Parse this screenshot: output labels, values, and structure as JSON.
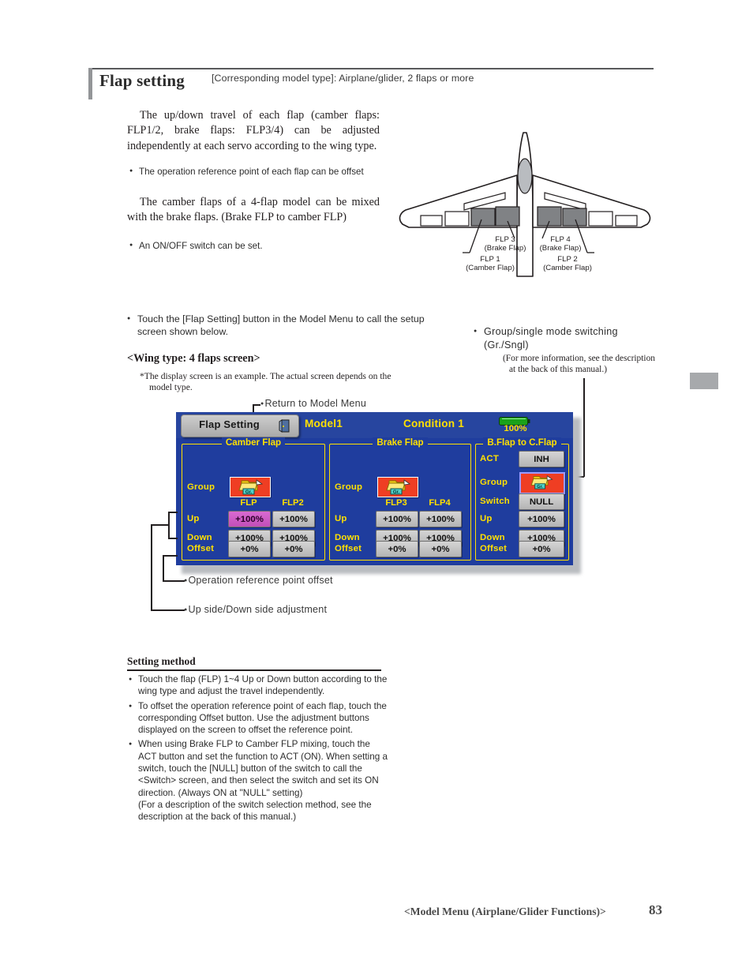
{
  "header": {
    "title": "Flap setting",
    "subtitle": "[Corresponding model type]: Airplane/glider, 2 flaps or more"
  },
  "intro": {
    "paragraph1": "The up/down travel of each flap (camber flaps: FLP1/2, brake flaps: FLP3/4) can be adjusted independently at each servo according to the wing type.",
    "bullet1": "The operation reference point of each flap can be offset",
    "paragraph2": "The camber flaps of a 4-flap model can be mixed with the brake flaps. (Brake FLP to camber FLP)",
    "bullet2": "An ON/OFF switch can be set."
  },
  "figure": {
    "labels": [
      {
        "name": "FLP  3",
        "type": "(Brake Flap)"
      },
      {
        "name": "FLP  4",
        "type": "(Brake Flap)"
      },
      {
        "name": "FLP 1",
        "type": "(Camber Flap)"
      },
      {
        "name": "FLP 2",
        "type": "(Camber Flap)"
      }
    ]
  },
  "instructions": {
    "touch_note": "Touch the [Flap Setting] button in the Model Menu to call the setup screen shown below.",
    "wing_type_heading": "<Wing type: 4 flaps screen>",
    "screen_note_line1": "*The display screen is an example. The actual screen depends on the",
    "screen_note_line2": "model type.",
    "group_note": "Group/single mode switching (Gr./Sngl)",
    "group_note_sub1": "(For more information, see the description",
    "group_note_sub2": "at the back of this manual.)"
  },
  "callouts": {
    "return_to_model_menu": "Return to Model Menu",
    "operation_reference_point_offset": "Operation reference point offset",
    "up_down_adjustment": "Up side/Down side adjustment"
  },
  "lcd": {
    "title_button": "Flap Setting",
    "door_icon": "exit-door-icon",
    "model_name": "Model1",
    "condition_name": "Condition 1",
    "battery_icon": "battery-icon",
    "battery_percent": "100%",
    "panels": {
      "camber": {
        "title": "Camber Flap",
        "group_label": "Group",
        "group_icon": "group-folder-icon",
        "group_icon_text": "Gr.",
        "columns": [
          "FLP",
          "FLP2"
        ],
        "rows": [
          {
            "label": "Up",
            "values": [
              "+100%",
              "+100%"
            ],
            "selected": 0
          },
          {
            "label": "Down",
            "values": [
              "+100%",
              "+100%"
            ],
            "selected": -1
          },
          {
            "label": "Offset",
            "values": [
              "+0%",
              "+0%"
            ],
            "selected": -1
          }
        ]
      },
      "brake": {
        "title": "Brake Flap",
        "group_label": "Group",
        "group_icon": "group-folder-icon",
        "group_icon_text": "Gr.",
        "columns": [
          "FLP3",
          "FLP4"
        ],
        "rows": [
          {
            "label": "Up",
            "values": [
              "+100%",
              "+100%"
            ],
            "selected": -1
          },
          {
            "label": "Down",
            "values": [
              "+100%",
              "+100%"
            ],
            "selected": -1
          },
          {
            "label": "Offset",
            "values": [
              "+0%",
              "+0%"
            ],
            "selected": -1
          }
        ]
      },
      "bflap_to_cflap": {
        "title": "B.Flap to C.Flap",
        "rows": [
          {
            "label": "ACT",
            "value": "INH"
          },
          {
            "label": "Group",
            "value": "",
            "icon": "group-folder-icon",
            "icon_text": "Gr."
          },
          {
            "label": "Switch",
            "value": "NULL"
          },
          {
            "label": "Up",
            "value": "+100%"
          },
          {
            "label": "Down",
            "value": "+100%"
          },
          {
            "label": "Offset",
            "value": "+0%"
          }
        ]
      }
    }
  },
  "setting_method": {
    "heading": "Setting method",
    "items": [
      "Touch the flap (FLP) 1~4 Up or Down button according to the wing type and adjust the travel independently.",
      "To offset the operation reference point of each flap, touch the corresponding Offset button. Use the adjustment buttons displayed on the screen to offset the reference point.",
      "When using Brake FLP to Camber FLP mixing, touch the ACT button and set the function to ACT (ON). When setting a switch, touch the [NULL] button of the switch to call the <Switch> screen, and then select the switch and set its ON direction. (Always ON at \"NULL\" setting)"
    ],
    "item3_continuation": "(For a description of the switch selection method, see the description at the back of this manual.)"
  },
  "footer": {
    "section": "<Model Menu (Airplane/Glider Functions)>",
    "page_number": "83"
  },
  "colors": {
    "lcd_background": "#1f3d9e",
    "lcd_accent": "#ffe000",
    "selected_button": "#c24fb8",
    "group_icon_bg": "#ef3e23",
    "battery_green": "#2db82d"
  }
}
